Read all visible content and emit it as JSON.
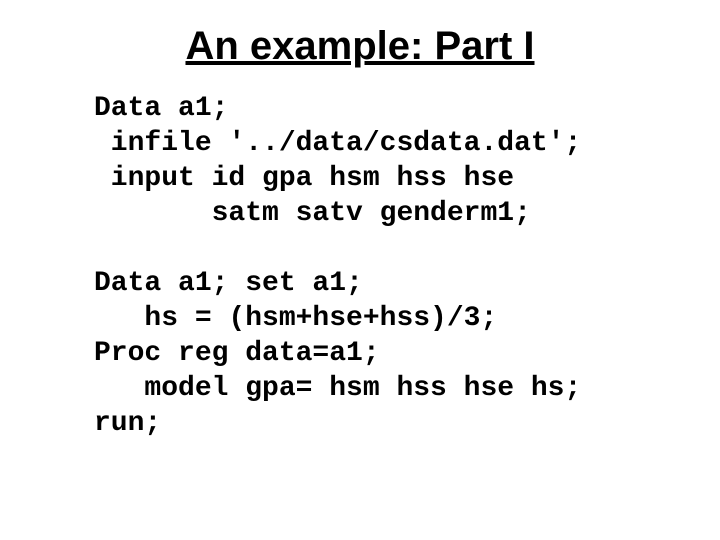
{
  "title": "An example: Part I",
  "code": "Data a1;\n infile '../data/csdata.dat';\n input id gpa hsm hss hse\n       satm satv genderm1;\n\nData a1; set a1;\n   hs = (hsm+hse+hss)/3;\nProc reg data=a1;\n   model gpa= hsm hss hse hs;\nrun;"
}
